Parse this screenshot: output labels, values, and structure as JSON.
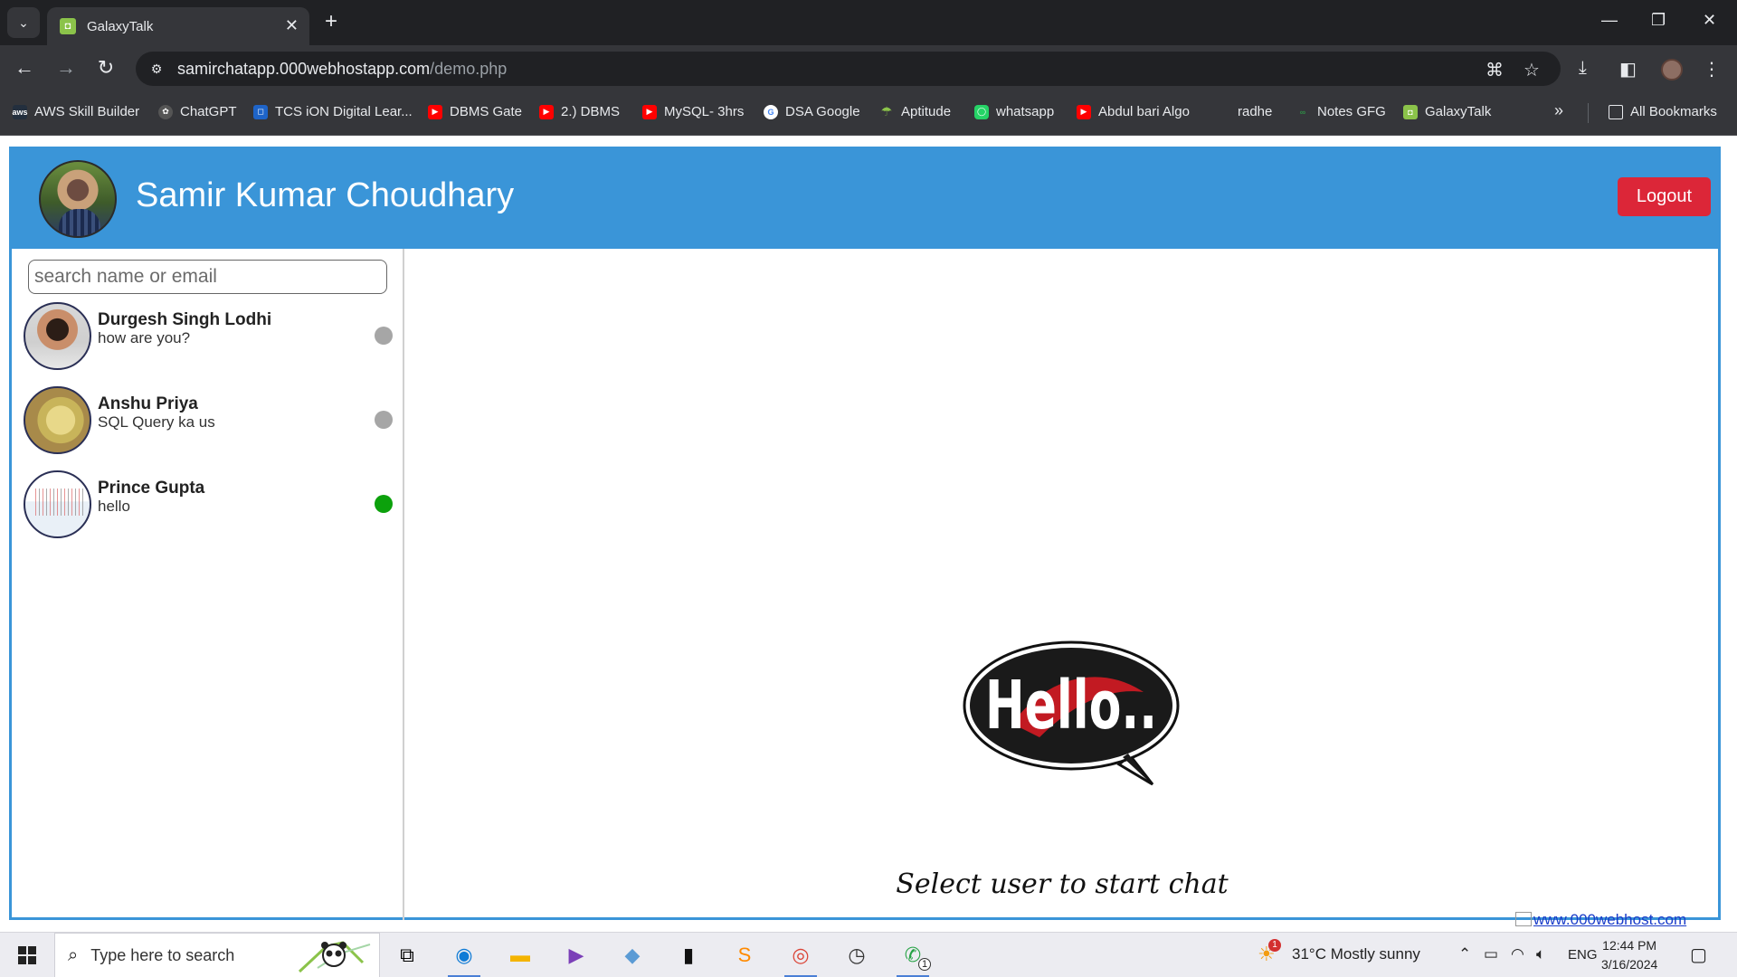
{
  "browser": {
    "tab_title": "GalaxyTalk",
    "url_host": "samirchatapp.000webhostapp.com",
    "url_path": "/demo.php",
    "bookmarks": [
      {
        "label": "AWS Skill Builder",
        "icon": "aws-icon"
      },
      {
        "label": "ChatGPT",
        "icon": "chatgpt-icon"
      },
      {
        "label": "TCS iON Digital Lear...",
        "icon": "tcs-icon"
      },
      {
        "label": "DBMS Gate",
        "icon": "youtube-icon"
      },
      {
        "label": "2.) DBMS",
        "icon": "youtube-icon"
      },
      {
        "label": "MySQL- 3hrs",
        "icon": "youtube-icon"
      },
      {
        "label": "DSA Google",
        "icon": "google-icon"
      },
      {
        "label": "Aptitude",
        "icon": "aptitude-icon"
      },
      {
        "label": "whatsapp",
        "icon": "whatsapp-icon"
      },
      {
        "label": "Abdul bari Algo",
        "icon": "youtube-icon"
      },
      {
        "label": "radhe",
        "icon": ""
      },
      {
        "label": "Notes GFG",
        "icon": "gfg-icon"
      },
      {
        "label": "GalaxyTalk",
        "icon": "galaxytalk-icon"
      }
    ],
    "all_bookmarks": "All Bookmarks"
  },
  "app": {
    "user_name": "Samir Kumar Choudhary",
    "logout_label": "Logout",
    "search_placeholder": "search name or email",
    "contacts": [
      {
        "name": "Durgesh Singh Lodhi",
        "last_message": "how are you?",
        "status": "offline",
        "status_color": "#a6a6a6"
      },
      {
        "name": "Anshu Priya",
        "last_message": "SQL Query ka us",
        "status": "offline",
        "status_color": "#a6a6a6"
      },
      {
        "name": "Prince Gupta",
        "last_message": "hello",
        "status": "online",
        "status_color": "#0ca10c"
      }
    ],
    "hello_text": "Hello..",
    "empty_prompt": "Select user to start chat",
    "hosted_link": "www.000webhost.com"
  },
  "colors": {
    "header_blue": "#3a95d8",
    "logout_red": "#dc2638"
  },
  "taskbar": {
    "search_placeholder": "Type here to search",
    "weather_badge": "1",
    "weather": "31°C  Mostly sunny",
    "language": "ENG",
    "time": "12:44 PM",
    "date": "3/16/2024",
    "whatsapp_badge": "1"
  }
}
